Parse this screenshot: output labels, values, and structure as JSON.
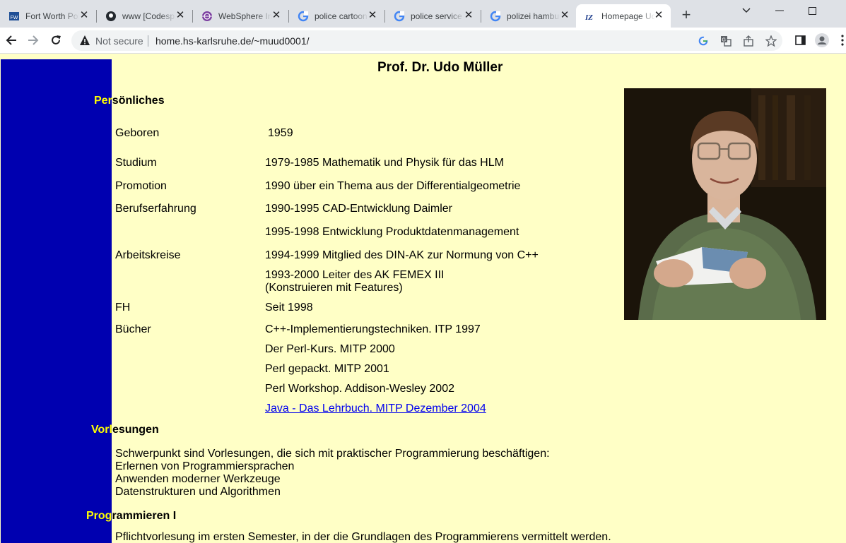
{
  "browser": {
    "tabs": [
      {
        "title": "Fort Worth Police",
        "favicon": "fw-logo-icon",
        "active": false
      },
      {
        "title": "www [Codesp...]",
        "favicon": "github-icon",
        "active": false
      },
      {
        "title": "WebSphere Integration",
        "favicon": "websphere-icon",
        "active": false
      },
      {
        "title": "police cartoon",
        "favicon": "google-icon",
        "active": false
      },
      {
        "title": "police service",
        "favicon": "google-icon",
        "active": false
      },
      {
        "title": "polizei hamburg",
        "favicon": "google-icon",
        "active": false
      },
      {
        "title": "Homepage Udo Müller",
        "favicon": "iz-icon",
        "active": true
      }
    ],
    "security_label": "Not secure",
    "url": "home.hs-karlsruhe.de/~muud0001/"
  },
  "page": {
    "title": "Prof. Dr. Udo Müller",
    "sections": {
      "personal": {
        "heading_highlight": "Per",
        "heading_rest": "sönliches"
      },
      "lectures": {
        "heading_highlight": "Vorl",
        "heading_rest": "esungen"
      },
      "programming": {
        "heading_highlight": "Prog",
        "heading_rest": "rammieren I"
      }
    },
    "personal_rows": [
      {
        "label": "Geboren",
        "value": "1959"
      },
      {
        "label": "Studium",
        "value": "1979-1985 Mathematik und Physik für das HLM"
      },
      {
        "label": "Promotion",
        "value": "1990 über ein Thema aus der Differentialgeometrie"
      },
      {
        "label": "Berufserfahrung",
        "value": "1990-1995 CAD-Entwicklung Daimler"
      },
      {
        "label": "",
        "value": "1995-1998 Entwicklung Produktdatenmanagement"
      },
      {
        "label": "Arbeitskreise",
        "value": "1994-1999 Mitglied des DIN-AK zur Normung von C++"
      },
      {
        "label": "",
        "value": "1993-2000 Leiter des AK FEMEX III"
      },
      {
        "label": "",
        "value": "(Konstruieren mit Features)"
      },
      {
        "label": "FH",
        "value": "Seit 1998"
      },
      {
        "label": "Bücher",
        "value": "C++-Implementierungstechniken. ITP 1997"
      },
      {
        "label": "",
        "value": "Der Perl-Kurs. MITP 2000"
      },
      {
        "label": "",
        "value": "Perl gepackt. MITP 2001"
      },
      {
        "label": "",
        "value": "Perl Workshop. Addison-Wesley 2002"
      }
    ],
    "book_link": "Java - Das Lehrbuch. MITP Dezember 2004",
    "lectures_text": [
      "Schwerpunkt sind Vorlesungen, die sich mit praktischer Programmierung beschäftigen:",
      "Erlernen von Programmiersprachen",
      "Anwenden moderner Werkzeuge",
      "Datenstrukturen und Algorithmen"
    ],
    "programming_text": "Pflichtvorlesung im ersten Semester, in der die Grundlagen des Programmierens vermittelt werden."
  },
  "colors": {
    "page_bg": "#ffffc6",
    "sidebar": "#0000b0",
    "heading_highlight": "#ffff00",
    "link": "#0000ee"
  }
}
